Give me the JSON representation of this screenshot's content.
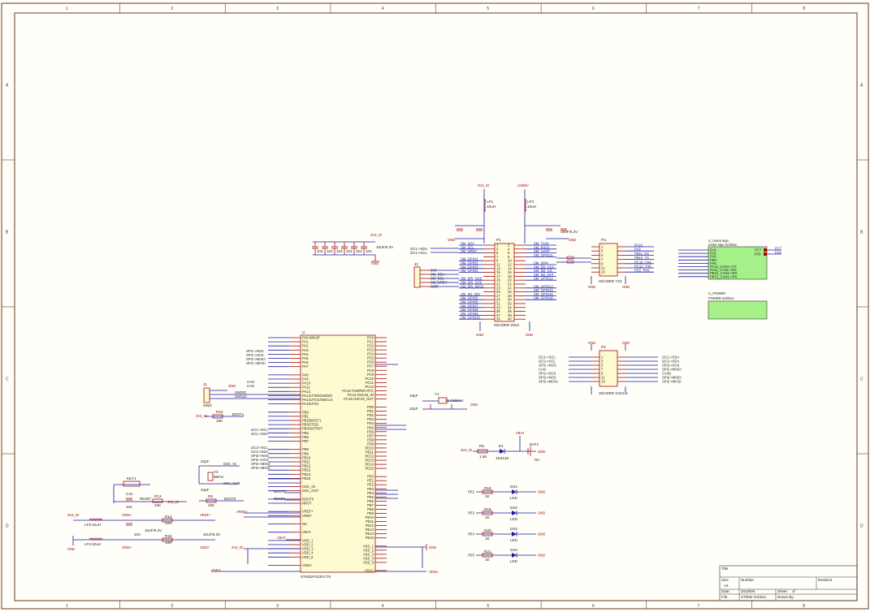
{
  "sheet": {
    "col_labels": [
      "1",
      "2",
      "3",
      "4",
      "5",
      "6",
      "7",
      "8"
    ],
    "row_labels": [
      "A",
      "B",
      "C",
      "D"
    ]
  },
  "mcu": {
    "ref": "U",
    "part": "STM32F103VCT6",
    "left_pins": [
      "PA0-WKUP",
      "PA1",
      "PA2",
      "PA3",
      "PA4",
      "PA5",
      "PA6",
      "PA7",
      "",
      "PA8",
      "PA9",
      "PA10",
      "PA11",
      "PA12",
      "PA13/JTMS/SWDIO",
      "PA14/JTCK/SWCLK",
      "PA15/JTDI",
      "",
      "PB0",
      "PB1",
      "PB2/BOOT1",
      "PB3/JTDO",
      "PB4/JNTRST",
      "PB5",
      "PB6",
      "PB7",
      "",
      "PB8",
      "PB9",
      "PB10",
      "PB11",
      "PB12",
      "PB13",
      "PB14",
      "PB15",
      "",
      "OSC_IN",
      "OSC_OUT",
      "",
      "BOOT0",
      "NRST",
      "",
      "VREF+",
      "VREF-",
      "",
      "NC",
      "",
      "VBAT",
      "",
      "VDD_1",
      "VDD_2",
      "VDD_3",
      "VDD_4",
      "VDD_5",
      "",
      "VDDA"
    ],
    "right_pins": [
      "PC0",
      "PC1",
      "PC2",
      "PC3",
      "PC4",
      "PC5",
      "PC6",
      "PC7",
      "PC8",
      "PC9",
      "PC10",
      "PC11",
      "PC12",
      "PC13-TAMPER-RTC",
      "PC14-OSC32_IN",
      "PC15-OSC32_OUT",
      "",
      "PD0",
      "PD1",
      "PD2",
      "PD3",
      "PD4",
      "PD5",
      "PD6",
      "PD7",
      "PD8",
      "PD9",
      "PD10",
      "PD11",
      "PD12",
      "PD13",
      "PD14",
      "PD15",
      "",
      "PE0",
      "PE1",
      "PE2",
      "PE3",
      "PE4",
      "PE5",
      "PE6",
      "PE7",
      "PE8",
      "PE9",
      "PE10",
      "PE11",
      "PE12",
      "PE13",
      "PE14",
      "PE15",
      "",
      "VSS_1",
      "VSS_2",
      "VSS_3",
      "VSS_4",
      "VSS_5",
      "",
      "VSSA"
    ]
  },
  "nets_left": [
    "SPI1->NSS",
    "SPI1->SCK",
    "SPI1->MISO",
    "SPI1->MOSI",
    "CAN",
    "CAN",
    "I2C1->SCL",
    "I2C1->SDA",
    "I2C2->SCL",
    "I2C2->SDA",
    "SPI2->NSS",
    "SPI2->SCK",
    "SPI2->MISO",
    "SPI2->MOSI"
  ],
  "power": {
    "v3": "3V3_IO",
    "v5": "USB5V",
    "v3_mod": "3V3_IO",
    "gnd": "GND",
    "vdda": "VDDA",
    "vref": "VREF+"
  },
  "header_j1": {
    "ref": "P1",
    "part": "HEADER 20X2",
    "left_nets": [
      "SM_SDA",
      "SM_SCL",
      "SM_DRDY",
      "",
      "SM_GPIO1",
      "SM_GPIO2",
      "SM_GPIO3",
      "SM_GPIO4",
      "",
      "SM_SPI_NSS",
      "SM_SPI_SCK",
      "SM_SPI_MOSI",
      "",
      "SM_SD_SDI",
      "SM_GPIO5",
      "SM_GPIO6",
      "SM_GPIO7",
      "SM_GPIO8",
      "SM_GPIO9",
      "SM_GPIO10"
    ],
    "right_nets": [
      "SM_TX3V",
      "SM_RX3V",
      "SM_UART",
      "SM_GPIO11",
      "",
      "SM_SPI4",
      "SM_SD_CLK",
      "SM_SD_CS",
      "SM_SD_DAT",
      "SM_GPIO12",
      "",
      "SM_GPIO13",
      "SM_GPIO14",
      "SM_GPIO15",
      "SM_GPIO16",
      "",
      "",
      "",
      "",
      ""
    ]
  },
  "header_p3": {
    "ref": "P3",
    "part": "HEADER 7X2",
    "left_nets": [
      "PB11_RX3",
      "PB10_TX3",
      "PA10_RX1",
      "PA9_TX1",
      "PA3_RX2",
      "PA2_TX2",
      "PC11_RX4"
    ],
    "right_nets": [
      "PA10",
      "PA9",
      "PB11_RX",
      "PB10_TX",
      "PC10_TX4",
      "PC12_TX5",
      "PD2_RX5"
    ]
  },
  "header_p4": {
    "ref": "P4",
    "part": "HEADER 10X2 H",
    "left_nets": [
      "I2C1->SCL",
      "I2C2->SCL",
      "SPI1->NSS",
      "CAN",
      "SPI1->SCK",
      "SPI2->NSS",
      "SPI2->MOSI"
    ],
    "right_nets": [
      "I2C1->SDA",
      "I2C2->SDA",
      "SPI2->SCK",
      "SPI1->MISO",
      "CAN2",
      "SPI2->MISO",
      "SPI2->MOSI"
    ]
  },
  "module_top": {
    "title": "U_motor sign",
    "subtitle": "motor sign SchDoc",
    "pins_left": [
      "PA4",
      "PA5",
      "PA6",
      "PB0",
      "PA6",
      "PA12_CAN1->TX",
      "PA11_CAN1->RX",
      "PB12_CAN2->RX",
      "PB13_CAN2->RX"
    ],
    "pins_right": [
      "PC7",
      "PA6"
    ]
  },
  "module_power": {
    "title": "U_POWER",
    "subtitle": "POWER.SchDoc"
  },
  "crystal_32k": {
    "ref": "Y1",
    "value": "32.768KHz",
    "c1": "10pF",
    "c2": "10pF"
  },
  "crystal_8m": {
    "ref": "Y2",
    "value": "8MHz",
    "c1": "22pF",
    "c2": "22pF"
  },
  "reset": {
    "ref": "KEY1",
    "r": "R13",
    "rv": "10K",
    "c": "C41",
    "cv": "104",
    "net": "RESET"
  },
  "boot": {
    "r1": "R9",
    "r1v": "10K",
    "r2": "R10",
    "r2v": "10K",
    "net": "BOOT0",
    "net1": "BOOT1"
  },
  "swd": {
    "ref": "J1",
    "part": "SWD",
    "pins": [
      "SWDIO",
      "SWCLK",
      "GND",
      "3V3"
    ]
  },
  "battery": {
    "ref": "BAT1",
    "diode": "D1",
    "diode_v": "1N4148",
    "r": "R5",
    "rv": "1.5K",
    "vbat": "VBAT",
    "nc": "NC"
  },
  "leds": [
    {
      "net": "PE2",
      "r": "R18",
      "rv": "1K",
      "d": "DS1",
      "dv": "LED"
    },
    {
      "net": "PE3",
      "r": "R19",
      "rv": "1K",
      "d": "DS2",
      "dv": "LED"
    },
    {
      "net": "PE4",
      "r": "R20",
      "rv": "1K",
      "d": "DS3",
      "dv": "LED"
    },
    {
      "net": "PE5",
      "r": "R21",
      "rv": "1K",
      "d": "DS4",
      "dv": "LED"
    }
  ],
  "decoupling": [
    "104",
    "104",
    "104",
    "104",
    "104",
    "104"
  ],
  "bulk_cap": {
    "ref": "C7",
    "value": "10uF/6.3V"
  },
  "inductors": [
    {
      "ref": "LP1",
      "value": "10uH",
      "net": "3V3_IO"
    },
    {
      "ref": "LP2",
      "value": "10uH",
      "net": "USB5V"
    },
    {
      "ref": "LP3",
      "value": "10uH",
      "net": "VDDA"
    },
    {
      "ref": "LP4",
      "value": "10uH",
      "net": "VREF+"
    }
  ],
  "filter": {
    "r1": "R14",
    "r1v": "10R",
    "r2": "R15",
    "r2v": "10R",
    "c": "10uF/6.3V",
    "cv": "104"
  },
  "j2": {
    "ref": "J2",
    "pins": [
      "3V3",
      "SM_SDA",
      "SM_SCL",
      "SM_DRDY",
      "GND"
    ]
  },
  "i2c_nets": [
    "I2C1->SDA",
    "I2C1->SCL"
  ],
  "title_block": {
    "title_label": "Title",
    "size_label": "Size",
    "size": "A2",
    "number_label": "Number",
    "revision_label": "Revision",
    "date_label": "Date:",
    "date": "2015/5/6",
    "sheet_label": "Sheet",
    "sheet_of": "of",
    "file_label": "File:",
    "file": "STM32 SchDoc",
    "drawn_label": "Drawn By:"
  }
}
